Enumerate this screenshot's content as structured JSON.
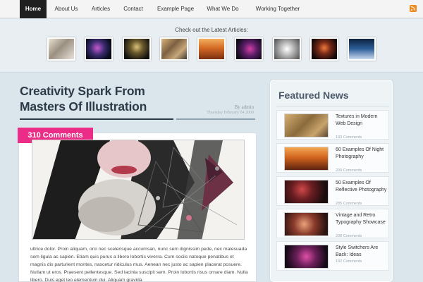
{
  "nav": {
    "items": [
      "Home",
      "About Us",
      "Articles",
      "Contact",
      "Example Page",
      "What We Do",
      "Working Together"
    ],
    "active": "Home",
    "rss_icon": "rss-icon"
  },
  "latest": {
    "title": "Check out the Latest Articles:"
  },
  "post": {
    "title": "Creativity Spark From Masters Of Illustration",
    "author": "By admin",
    "date": "Thursday February 04 2009",
    "comments": "310 Comments",
    "excerpt": "ultrice dolor. Proin aliquam, orci nec scelerisque accumsan, nunc sem dignissim pede, nec malesuada sem ligula ac sapien. Etiam quis purus a libero lobortis viverra. Cum sociis natoque penatibus et magnis dis parturient montes, nascetur ridiculus mus. Aenean nec justo ac sapien placerat posuere. Nullam ut eros. Praesent pellentesque. Sed lacinia suscipit sem. Proin lobortis risus ornare diam. Nulla libero. Duis eget leo elementum dui. Aliquam gravida"
  },
  "sidebar": {
    "title": "Featured News",
    "items": [
      {
        "title": "Textures in Modern Web Design",
        "count": "193 Comments"
      },
      {
        "title": "60 Examples Of Night Photography",
        "count": "209 Comments"
      },
      {
        "title": "50 Examples Of Reflective Photography",
        "count": "285 Comments"
      },
      {
        "title": "Vintage and Retro Typography Showcase",
        "count": "208 Comments"
      },
      {
        "title": "Style Switchers Are Back: Ideas",
        "count": "192 Comments"
      }
    ]
  },
  "colors": {
    "accent_pink": "#ec2d87",
    "nav_active": "#1f1f1f",
    "title": "#2d3a48",
    "rss": "#f28a1c"
  }
}
